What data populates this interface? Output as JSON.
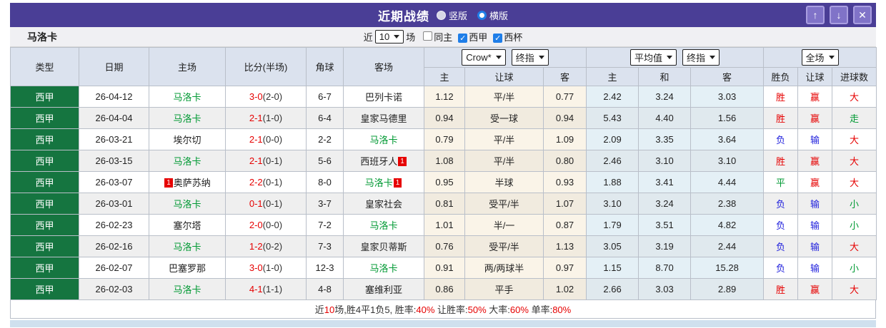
{
  "titlebar": {
    "title": "近期战绩",
    "radio_vertical": "竖版",
    "radio_horizontal": "横版",
    "selected": "横版",
    "buttons": {
      "up": "↑",
      "down": "↓",
      "close": "✕"
    }
  },
  "filter": {
    "team": "马洛卡",
    "near_label": "近",
    "games_value": "10",
    "games_suffix": "场",
    "checkboxes": [
      {
        "label": "同主",
        "checked": false
      },
      {
        "label": "西甲",
        "checked": true
      },
      {
        "label": "西杯",
        "checked": true
      }
    ]
  },
  "table": {
    "static_headers": [
      "类型",
      "日期",
      "主场",
      "比分(半场)",
      "角球",
      "客场"
    ],
    "group_handicap": {
      "dropdown1": "Crow*",
      "dropdown2": "终指",
      "subheaders": [
        "主",
        "让球",
        "客"
      ]
    },
    "group_average": {
      "dropdown1": "平均值",
      "dropdown2": "终指",
      "subheaders": [
        "主",
        "和",
        "客"
      ]
    },
    "group_result": {
      "dropdown": "全场",
      "subheaders": [
        "胜负",
        "让球",
        "进球数"
      ]
    },
    "rows": [
      {
        "league": "西甲",
        "date": "26-04-12",
        "home": {
          "name": "马洛卡",
          "green": true
        },
        "score": "3-0",
        "half": "(2-0)",
        "corners": "6-7",
        "away": {
          "name": "巴列卡诺",
          "green": false
        },
        "handicap": {
          "home": "1.12",
          "line": "平/半",
          "away": "0.77"
        },
        "average": {
          "home": "2.42",
          "draw": "3.24",
          "away": "3.03"
        },
        "results": [
          {
            "text": "胜",
            "color": "red"
          },
          {
            "text": "赢",
            "color": "red"
          },
          {
            "text": "大",
            "color": "red"
          }
        ]
      },
      {
        "league": "西甲",
        "date": "26-04-04",
        "home": {
          "name": "马洛卡",
          "green": true
        },
        "score": "2-1",
        "half": "(1-0)",
        "corners": "6-4",
        "away": {
          "name": "皇家马德里",
          "green": false
        },
        "handicap": {
          "home": "0.94",
          "line": "受一球",
          "away": "0.94"
        },
        "average": {
          "home": "5.43",
          "draw": "4.40",
          "away": "1.56"
        },
        "results": [
          {
            "text": "胜",
            "color": "red"
          },
          {
            "text": "赢",
            "color": "red"
          },
          {
            "text": "走",
            "color": "green"
          }
        ]
      },
      {
        "league": "西甲",
        "date": "26-03-21",
        "home": {
          "name": "埃尔切",
          "green": false
        },
        "score": "2-1",
        "half": "(0-0)",
        "corners": "2-2",
        "away": {
          "name": "马洛卡",
          "green": true
        },
        "handicap": {
          "home": "0.79",
          "line": "平/半",
          "away": "1.09"
        },
        "average": {
          "home": "2.09",
          "draw": "3.35",
          "away": "3.64"
        },
        "results": [
          {
            "text": "负",
            "color": "blue"
          },
          {
            "text": "输",
            "color": "blue"
          },
          {
            "text": "大",
            "color": "red"
          }
        ]
      },
      {
        "league": "西甲",
        "date": "26-03-15",
        "home": {
          "name": "马洛卡",
          "green": true
        },
        "score": "2-1",
        "half": "(0-1)",
        "corners": "5-6",
        "away": {
          "name": "西班牙人",
          "green": false,
          "badge_after": "1"
        },
        "handicap": {
          "home": "1.08",
          "line": "平/半",
          "away": "0.80"
        },
        "average": {
          "home": "2.46",
          "draw": "3.10",
          "away": "3.10"
        },
        "results": [
          {
            "text": "胜",
            "color": "red"
          },
          {
            "text": "赢",
            "color": "red"
          },
          {
            "text": "大",
            "color": "red"
          }
        ]
      },
      {
        "league": "西甲",
        "date": "26-03-07",
        "home": {
          "name": "奥萨苏纳",
          "green": false,
          "badge_before": "1"
        },
        "score": "2-2",
        "half": "(0-1)",
        "corners": "8-0",
        "away": {
          "name": "马洛卡",
          "green": true,
          "badge_after": "1"
        },
        "handicap": {
          "home": "0.95",
          "line": "半球",
          "away": "0.93"
        },
        "average": {
          "home": "1.88",
          "draw": "3.41",
          "away": "4.44"
        },
        "results": [
          {
            "text": "平",
            "color": "green"
          },
          {
            "text": "赢",
            "color": "red"
          },
          {
            "text": "大",
            "color": "red"
          }
        ]
      },
      {
        "league": "西甲",
        "date": "26-03-01",
        "home": {
          "name": "马洛卡",
          "green": true
        },
        "score": "0-1",
        "half": "(0-1)",
        "corners": "3-7",
        "away": {
          "name": "皇家社会",
          "green": false
        },
        "handicap": {
          "home": "0.81",
          "line": "受平/半",
          "away": "1.07"
        },
        "average": {
          "home": "3.10",
          "draw": "3.24",
          "away": "2.38"
        },
        "results": [
          {
            "text": "负",
            "color": "blue"
          },
          {
            "text": "输",
            "color": "blue"
          },
          {
            "text": "小",
            "color": "green"
          }
        ]
      },
      {
        "league": "西甲",
        "date": "26-02-23",
        "home": {
          "name": "塞尔塔",
          "green": false
        },
        "score": "2-0",
        "half": "(0-0)",
        "corners": "7-2",
        "away": {
          "name": "马洛卡",
          "green": true
        },
        "handicap": {
          "home": "1.01",
          "line": "半/一",
          "away": "0.87"
        },
        "average": {
          "home": "1.79",
          "draw": "3.51",
          "away": "4.82"
        },
        "results": [
          {
            "text": "负",
            "color": "blue"
          },
          {
            "text": "输",
            "color": "blue"
          },
          {
            "text": "小",
            "color": "green"
          }
        ]
      },
      {
        "league": "西甲",
        "date": "26-02-16",
        "home": {
          "name": "马洛卡",
          "green": true
        },
        "score": "1-2",
        "half": "(0-2)",
        "corners": "7-3",
        "away": {
          "name": "皇家贝蒂斯",
          "green": false
        },
        "handicap": {
          "home": "0.76",
          "line": "受平/半",
          "away": "1.13"
        },
        "average": {
          "home": "3.05",
          "draw": "3.19",
          "away": "2.44"
        },
        "results": [
          {
            "text": "负",
            "color": "blue"
          },
          {
            "text": "输",
            "color": "blue"
          },
          {
            "text": "大",
            "color": "red"
          }
        ]
      },
      {
        "league": "西甲",
        "date": "26-02-07",
        "home": {
          "name": "巴塞罗那",
          "green": false
        },
        "score": "3-0",
        "half": "(1-0)",
        "corners": "12-3",
        "away": {
          "name": "马洛卡",
          "green": true
        },
        "handicap": {
          "home": "0.91",
          "line": "两/两球半",
          "away": "0.97"
        },
        "average": {
          "home": "1.15",
          "draw": "8.70",
          "away": "15.28"
        },
        "results": [
          {
            "text": "负",
            "color": "blue"
          },
          {
            "text": "输",
            "color": "blue"
          },
          {
            "text": "小",
            "color": "green"
          }
        ]
      },
      {
        "league": "西甲",
        "date": "26-02-03",
        "home": {
          "name": "马洛卡",
          "green": true
        },
        "score": "4-1",
        "half": "(1-1)",
        "corners": "4-8",
        "away": {
          "name": "塞维利亚",
          "green": false
        },
        "handicap": {
          "home": "0.86",
          "line": "平手",
          "away": "1.02"
        },
        "average": {
          "home": "2.66",
          "draw": "3.03",
          "away": "2.89"
        },
        "results": [
          {
            "text": "胜",
            "color": "red"
          },
          {
            "text": "赢",
            "color": "red"
          },
          {
            "text": "大",
            "color": "red"
          }
        ]
      }
    ]
  },
  "footer": {
    "segments": [
      {
        "text": "近",
        "color": "dark"
      },
      {
        "text": "10",
        "color": "red"
      },
      {
        "text": "场,胜4平1负5, 胜率:",
        "color": "dark"
      },
      {
        "text": "40%",
        "color": "red"
      },
      {
        "text": " 让胜率:",
        "color": "dark"
      },
      {
        "text": "50%",
        "color": "red"
      },
      {
        "text": " 大率:",
        "color": "dark"
      },
      {
        "text": "60%",
        "color": "red"
      },
      {
        "text": " 单率:",
        "color": "dark"
      },
      {
        "text": "80%",
        "color": "red"
      }
    ]
  },
  "colors": {
    "titlebar_bg": "#4a3e96",
    "league_badge_bg": "#157540",
    "mallorca_green": "#009933",
    "win_red": "#e60000",
    "lose_blue": "#2222dd",
    "handicap_cell_bg": "#faf4e8",
    "average_cell_bg": "#e4f0f6",
    "header_cell_bg": "#dbe2ee"
  }
}
